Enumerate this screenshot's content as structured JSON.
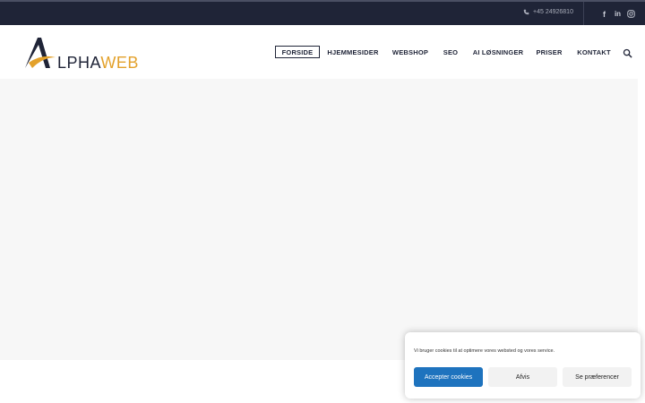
{
  "topbar": {
    "phone": "+45 24926810",
    "social": [
      {
        "name": "facebook",
        "glyph": "f"
      },
      {
        "name": "linkedin",
        "glyph": "in"
      },
      {
        "name": "instagram",
        "glyph": ""
      }
    ]
  },
  "logo": {
    "alpha": "LPHA",
    "web": "WEB"
  },
  "nav": {
    "items": [
      "FORSIDE",
      "HJEMMESIDER",
      "WEBSHOP",
      "SEO",
      "AI LØSNINGER",
      "PRISER",
      "KONTAKT"
    ],
    "active": "FORSIDE"
  },
  "cookie": {
    "message": "Vi bruger cookies til at optimere vores websted og vores service.",
    "accept": "Accepter cookies",
    "deny": "Afvis",
    "preferences": "Se præferencer"
  },
  "colors": {
    "topbar_bg": "#1f2437",
    "brand_dark": "#1f2437",
    "brand_accent": "#e3a12b",
    "accept_button": "#1e73be"
  }
}
